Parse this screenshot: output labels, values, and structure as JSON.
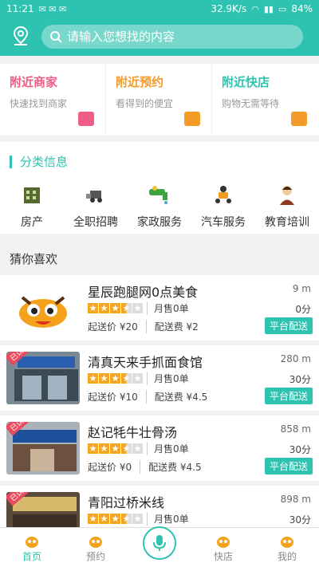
{
  "status": {
    "time": "11:21",
    "speed": "32.9K/s",
    "battery": "84%"
  },
  "search": {
    "placeholder": "请输入您想找的内容"
  },
  "cards": [
    {
      "title": "附近商家",
      "subtitle": "快速找到商家",
      "color": "#ef5c85"
    },
    {
      "title": "附近预约",
      "subtitle": "看得到的便宜",
      "color": "#f39a29"
    },
    {
      "title": "附近快店",
      "subtitle": "购物无需等待",
      "color": "#2ec3b0"
    }
  ],
  "category": {
    "title": "分类信息",
    "items": [
      {
        "label": "房产",
        "icon": "building-icon"
      },
      {
        "label": "全职招聘",
        "icon": "forklift-icon"
      },
      {
        "label": "家政服务",
        "icon": "faucet-icon"
      },
      {
        "label": "汽车服务",
        "icon": "scooter-icon"
      },
      {
        "label": "教育培训",
        "icon": "teacher-icon"
      }
    ]
  },
  "guess_title": "猜你喜欢",
  "shops": [
    {
      "name": "星辰跑腿网0点美食",
      "distance": "9 m",
      "stars": 3.5,
      "sales": "月售0单",
      "minutes": "0分",
      "min_price": "起送价 ¥20",
      "delivery_fee": "配送费 ¥2",
      "tag": "平台配送"
    },
    {
      "name": "清真天来手抓面食馆",
      "distance": "280 m",
      "stars": 3.5,
      "sales": "月售0单",
      "minutes": "30分",
      "min_price": "起送价 ¥10",
      "delivery_fee": "配送费 ¥4.5",
      "tag": "平台配送",
      "badge": "已认证"
    },
    {
      "name": "赵记牦牛壮骨汤",
      "distance": "858 m",
      "stars": 3.5,
      "sales": "月售0单",
      "minutes": "30分",
      "min_price": "起送价 ¥0",
      "delivery_fee": "配送费 ¥4.5",
      "tag": "平台配送",
      "badge": "已认证"
    },
    {
      "name": "青阳过桥米线",
      "distance": "898 m",
      "stars": 3.5,
      "sales": "月售0单",
      "minutes": "30分",
      "min_price": "",
      "delivery_fee": "",
      "tag": "",
      "badge": "已认证"
    }
  ],
  "tabs": [
    {
      "label": "首页",
      "active": true
    },
    {
      "label": "预约",
      "active": false
    },
    {
      "label": "",
      "active": false
    },
    {
      "label": "快店",
      "active": false
    },
    {
      "label": "我的",
      "active": false
    }
  ],
  "accent": "#2ec3b0"
}
